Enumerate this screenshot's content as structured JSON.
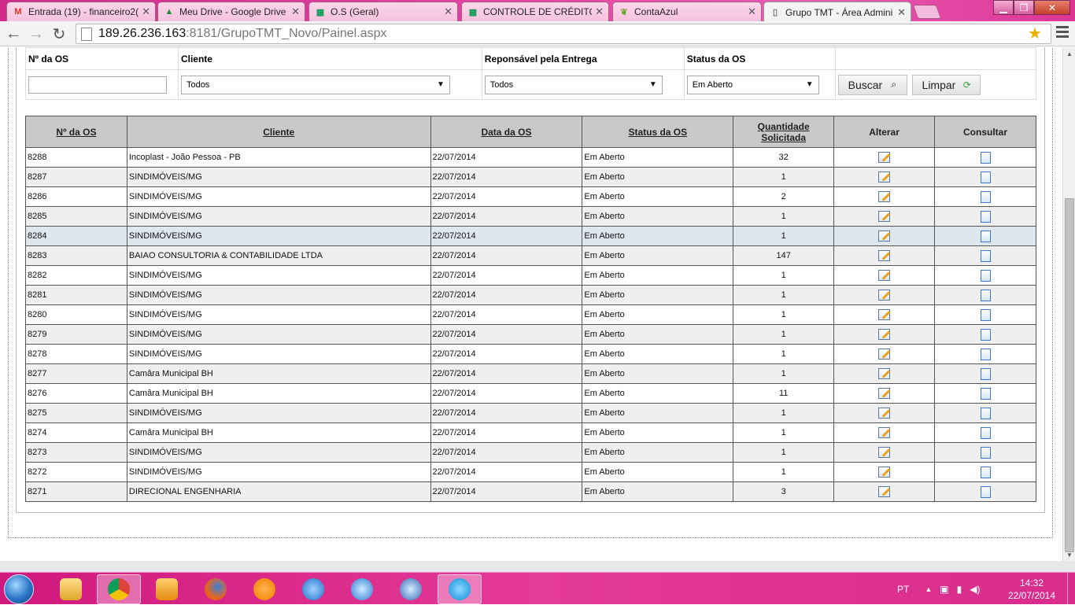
{
  "browser": {
    "tabs": [
      {
        "label": "Entrada (19) - financeiro2(",
        "icon": "gmail-icon"
      },
      {
        "label": "Meu Drive - Google Drive",
        "icon": "drive-icon"
      },
      {
        "label": "O.S (Geral)",
        "icon": "sheets-icon"
      },
      {
        "label": "CONTROLE DE CRÉDITOS",
        "icon": "sheets-icon"
      },
      {
        "label": "ContaAzul",
        "icon": "leaf-icon"
      },
      {
        "label": "Grupo TMT - Área Admini",
        "icon": "page-icon"
      }
    ],
    "url_host": "189.26.236.163",
    "url_rest": ":8181/GrupoTMT_Novo/Painel.aspx"
  },
  "filters": {
    "labels": {
      "os": "Nº da OS",
      "cliente": "Cliente",
      "responsavel": "Reponsável pela Entrega",
      "status": "Status da OS"
    },
    "values": {
      "os": "",
      "cliente": "Todos",
      "responsavel": "Todos",
      "status": "Em Aberto"
    },
    "buttons": {
      "buscar": "Buscar",
      "limpar": "Limpar"
    }
  },
  "grid": {
    "headers": {
      "os": "Nº da OS",
      "cliente": "Cliente",
      "data": "Data da OS",
      "status": "Status da OS",
      "quantidade_1": "Quantidade",
      "quantidade_2": "Solicitada",
      "alterar": "Alterar",
      "consultar": "Consultar"
    },
    "rows": [
      {
        "os": "8288",
        "cliente": "Incoplast - João Pessoa - PB",
        "data": "22/07/2014",
        "status": "Em Aberto",
        "qtd": "32"
      },
      {
        "os": "8287",
        "cliente": "SINDIMÓVEIS/MG",
        "data": "22/07/2014",
        "status": "Em Aberto",
        "qtd": "1"
      },
      {
        "os": "8286",
        "cliente": "SINDIMÓVEIS/MG",
        "data": "22/07/2014",
        "status": "Em Aberto",
        "qtd": "2"
      },
      {
        "os": "8285",
        "cliente": "SINDIMÓVEIS/MG",
        "data": "22/07/2014",
        "status": "Em Aberto",
        "qtd": "1"
      },
      {
        "os": "8284",
        "cliente": "SINDIMÓVEIS/MG",
        "data": "22/07/2014",
        "status": "Em Aberto",
        "qtd": "1"
      },
      {
        "os": "8283",
        "cliente": "BAIAO CONSULTORIA & CONTABILIDADE LTDA",
        "data": "22/07/2014",
        "status": "Em Aberto",
        "qtd": "147"
      },
      {
        "os": "8282",
        "cliente": "SINDIMÓVEIS/MG",
        "data": "22/07/2014",
        "status": "Em Aberto",
        "qtd": "1"
      },
      {
        "os": "8281",
        "cliente": "SINDIMÓVEIS/MG",
        "data": "22/07/2014",
        "status": "Em Aberto",
        "qtd": "1"
      },
      {
        "os": "8280",
        "cliente": "SINDIMÓVEIS/MG",
        "data": "22/07/2014",
        "status": "Em Aberto",
        "qtd": "1"
      },
      {
        "os": "8279",
        "cliente": "SINDIMÓVEIS/MG",
        "data": "22/07/2014",
        "status": "Em Aberto",
        "qtd": "1"
      },
      {
        "os": "8278",
        "cliente": "SINDIMÓVEIS/MG",
        "data": "22/07/2014",
        "status": "Em Aberto",
        "qtd": "1"
      },
      {
        "os": "8277",
        "cliente": "Camâra Municipal BH",
        "data": "22/07/2014",
        "status": "Em Aberto",
        "qtd": "1"
      },
      {
        "os": "8276",
        "cliente": "Camâra Municipal BH",
        "data": "22/07/2014",
        "status": "Em Aberto",
        "qtd": "11"
      },
      {
        "os": "8275",
        "cliente": "SINDIMÓVEIS/MG",
        "data": "22/07/2014",
        "status": "Em Aberto",
        "qtd": "1"
      },
      {
        "os": "8274",
        "cliente": "Camâra Municipal BH",
        "data": "22/07/2014",
        "status": "Em Aberto",
        "qtd": "1"
      },
      {
        "os": "8273",
        "cliente": "SINDIMÓVEIS/MG",
        "data": "22/07/2014",
        "status": "Em Aberto",
        "qtd": "1"
      },
      {
        "os": "8272",
        "cliente": "SINDIMÓVEIS/MG",
        "data": "22/07/2014",
        "status": "Em Aberto",
        "qtd": "1"
      },
      {
        "os": "8271",
        "cliente": "DIRECIONAL ENGENHARIA",
        "data": "22/07/2014",
        "status": "Em Aberto",
        "qtd": "3"
      }
    ]
  },
  "taskbar": {
    "apps": [
      "explorer-icon",
      "chrome-icon",
      "outlook-icon",
      "firefox-icon",
      "avast-icon",
      "app-icon",
      "itunes-icon",
      "network-icon",
      "skype-icon"
    ],
    "language": "PT",
    "time": "14:32",
    "date": "22/07/2014"
  },
  "colors": {
    "header_bg": "#c9c9c9",
    "alt_row": "#efefef",
    "highlight_row": "#dfe7ee",
    "theme_pink": "#e040a0"
  }
}
